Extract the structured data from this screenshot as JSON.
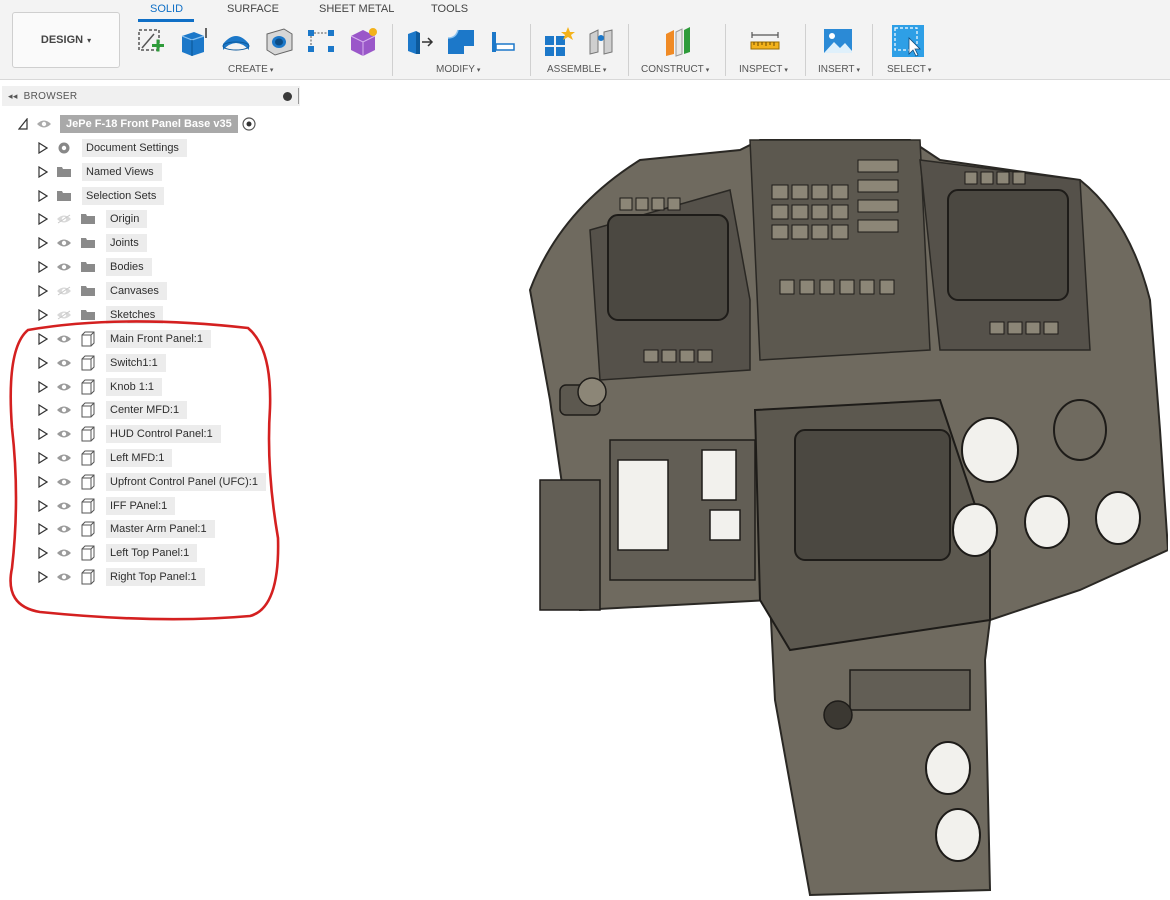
{
  "toolbar": {
    "design_label": "DESIGN",
    "tabs": [
      "SOLID",
      "SURFACE",
      "SHEET METAL",
      "TOOLS"
    ],
    "active_tab": "SOLID",
    "groups": {
      "create": "CREATE",
      "modify": "MODIFY",
      "assemble": "ASSEMBLE",
      "construct": "CONSTRUCT",
      "inspect": "INSPECT",
      "insert": "INSERT",
      "select": "SELECT"
    },
    "caret": "▾"
  },
  "browser": {
    "title": "BROWSER",
    "collapse_glyph": "◂◂",
    "root": "JePe F-18 Front Panel Base v35",
    "folders": [
      "Document Settings",
      "Named Views",
      "Selection Sets",
      "Origin",
      "Joints",
      "Bodies",
      "Canvases",
      "Sketches"
    ],
    "components": [
      "Main Front Panel:1",
      "Switch1:1",
      "Knob 1:1",
      "Center MFD:1",
      "HUD Control Panel:1",
      "Left MFD:1",
      "Upfront Control Panel (UFC):1",
      "IFF PAnel:1",
      "Master Arm Panel:1",
      "Left Top Panel:1",
      "Right Top Panel:1"
    ]
  },
  "colors": {
    "accent": "#0f6fc6",
    "annotation": "#d42020",
    "model_fill": "#6f6a5f",
    "model_dark": "#3b3832",
    "model_light": "#8c8677"
  }
}
